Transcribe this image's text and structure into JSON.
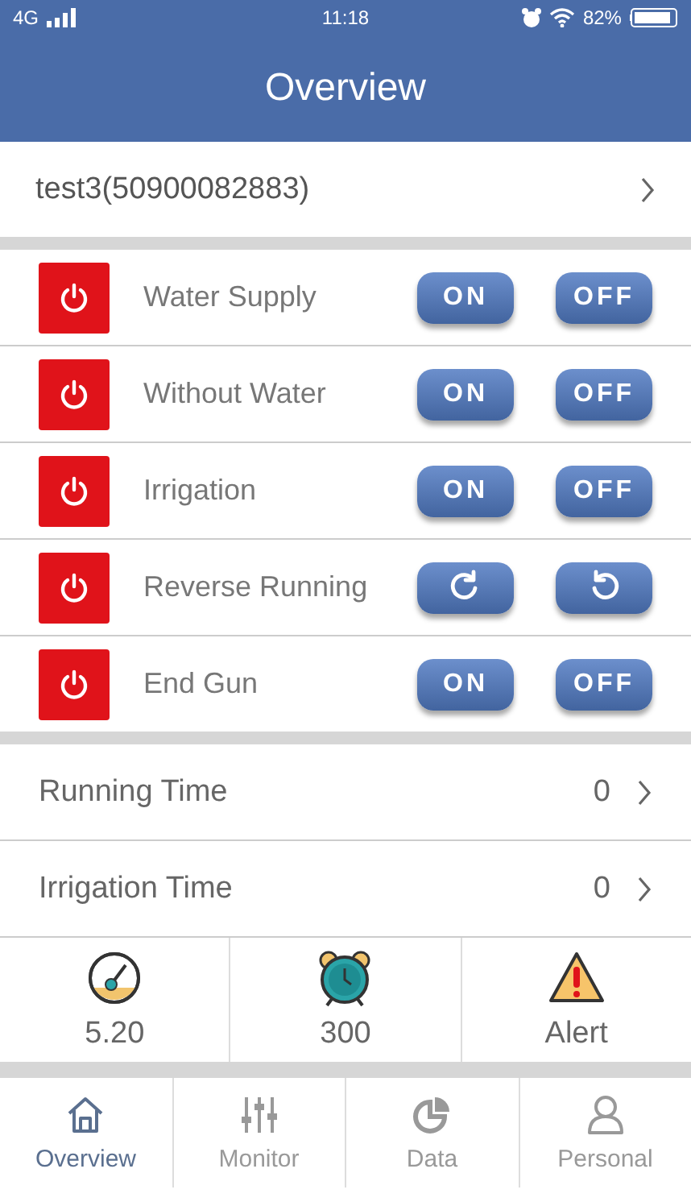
{
  "status_bar": {
    "network": "4G",
    "time": "11:18",
    "battery": "82%"
  },
  "header": {
    "title": "Overview"
  },
  "device": {
    "name": "test3(50900082883)"
  },
  "controls": [
    {
      "label": "Water Supply",
      "kind": "onoff",
      "buttons": [
        "ON",
        "OFF"
      ]
    },
    {
      "label": "Without Water",
      "kind": "onoff",
      "buttons": [
        "ON",
        "OFF"
      ]
    },
    {
      "label": "Irrigation",
      "kind": "onoff",
      "buttons": [
        "ON",
        "OFF"
      ]
    },
    {
      "label": "Reverse Running",
      "kind": "rotate"
    },
    {
      "label": "End Gun",
      "kind": "onoff",
      "buttons": [
        "ON",
        "OFF"
      ]
    }
  ],
  "times": [
    {
      "label": "Running Time",
      "value": "0"
    },
    {
      "label": "Irrigation Time",
      "value": "0"
    }
  ],
  "stats": [
    {
      "kind": "gauge",
      "value": "5.20"
    },
    {
      "kind": "clock",
      "value": "300"
    },
    {
      "kind": "alert",
      "value": "Alert"
    }
  ],
  "tabs": [
    {
      "label": "Overview",
      "kind": "home",
      "selected": true
    },
    {
      "label": "Monitor",
      "kind": "sliders",
      "selected": false
    },
    {
      "label": "Data",
      "kind": "pie",
      "selected": false
    },
    {
      "label": "Personal",
      "kind": "person",
      "selected": false
    }
  ]
}
